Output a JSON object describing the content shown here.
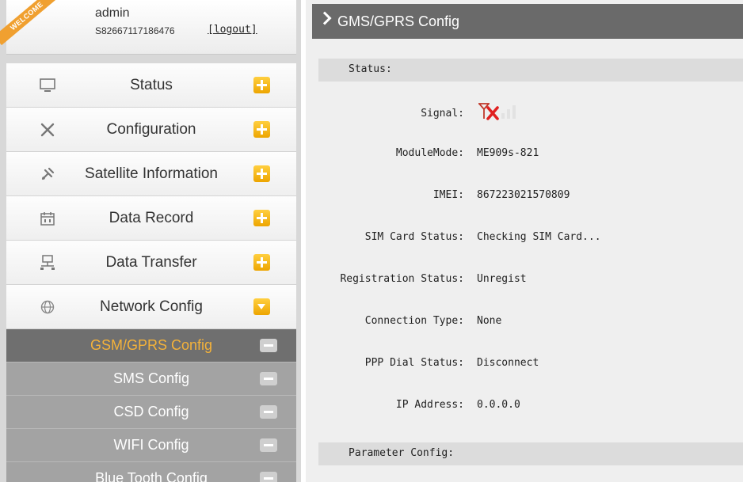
{
  "user": {
    "welcome": "WELCOME",
    "name": "admin",
    "serial": "S82667117186476",
    "logout": "[logout]"
  },
  "sidebar": {
    "items": [
      {
        "label": "Status",
        "icon": "monitor-icon"
      },
      {
        "label": "Configuration",
        "icon": "tools-icon"
      },
      {
        "label": "Satellite Information",
        "icon": "satellite-icon"
      },
      {
        "label": "Data Record",
        "icon": "calendar-icon"
      },
      {
        "label": "Data Transfer",
        "icon": "network-icon"
      },
      {
        "label": "Network Config",
        "icon": "globe-icon",
        "expanded": true
      }
    ],
    "sub_items": [
      {
        "label": "GSM/GPRS Config",
        "active": true
      },
      {
        "label": "SMS Config"
      },
      {
        "label": "CSD Config"
      },
      {
        "label": "WIFI Config"
      },
      {
        "label": "Blue Tooth Config"
      }
    ]
  },
  "main": {
    "title": "GMS/GPRS Config",
    "status_section": "Status:",
    "parameter_section": "Parameter Config:",
    "status": {
      "signal": {
        "label": "Signal:",
        "icon": "signal-no-service-icon"
      },
      "module_mode": {
        "label": "ModuleMode:",
        "value": "ME909s-821"
      },
      "imei": {
        "label": "IMEI:",
        "value": "867223021570809"
      },
      "sim_card_status": {
        "label": "SIM Card Status:",
        "value": "Checking SIM Card..."
      },
      "registration_status": {
        "label": "Registration Status:",
        "value": "Unregist"
      },
      "connection_type": {
        "label": "Connection Type:",
        "value": "None"
      },
      "ppp_dial_status": {
        "label": "PPP Dial Status:",
        "value": "Disconnect"
      },
      "ip_address": {
        "label": "IP Address:",
        "value": "0.0.0.0"
      }
    }
  },
  "colors": {
    "accent_orange": "#f4b23a",
    "title_bar": "#6a6a6a",
    "signal_x": "#e02020"
  }
}
